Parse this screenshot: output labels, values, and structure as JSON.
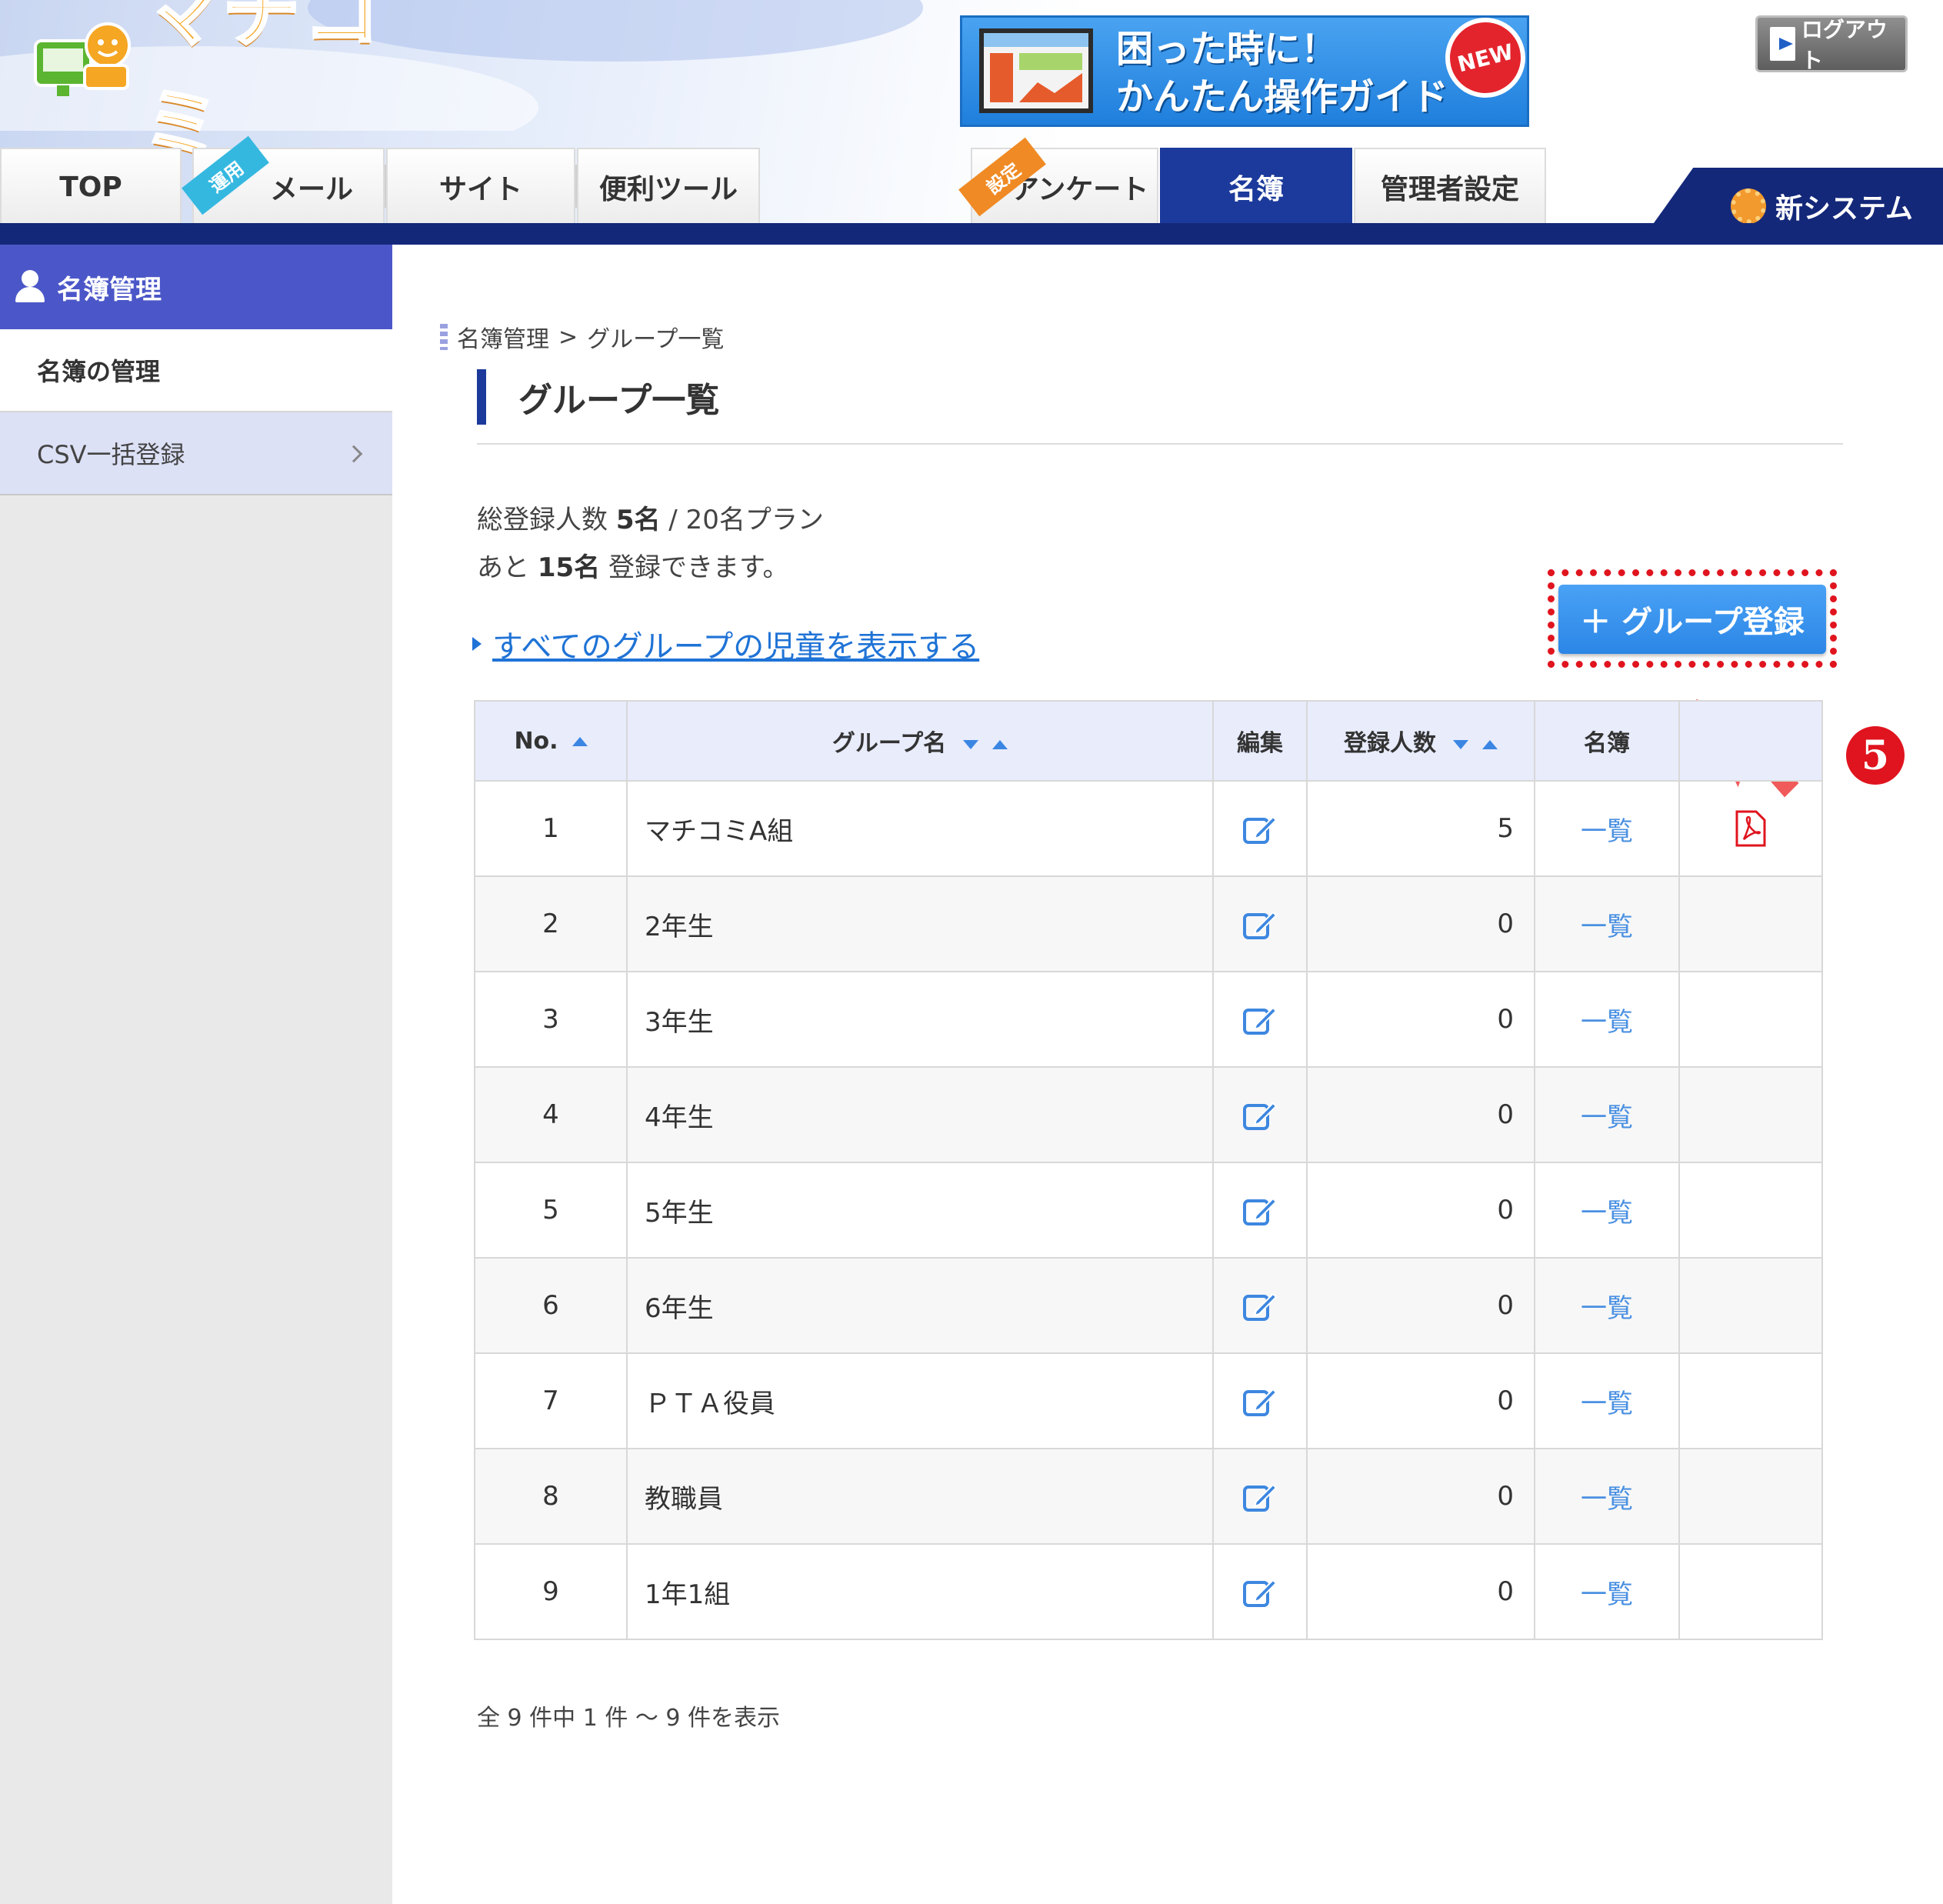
{
  "app": {
    "logo_text": "マチコミ",
    "guide_banner": {
      "line1": "困った時に！",
      "line2": "かんたん操作ガイド",
      "badge": "NEW"
    },
    "logout_label": "ログアウト",
    "new_system_label": "新システム"
  },
  "nav": {
    "tabs": [
      {
        "label": "TOP"
      },
      {
        "label": "メール",
        "ribbon": "運用"
      },
      {
        "label": "サイト"
      },
      {
        "label": "便利ツール"
      },
      {
        "label": "アンケート",
        "ribbon": "設定"
      },
      {
        "label": "名簿",
        "active": true
      },
      {
        "label": "管理者設定"
      }
    ]
  },
  "sidebar": {
    "header": "名簿管理",
    "items": [
      {
        "label": "名簿の管理"
      },
      {
        "label": "CSV一括登録"
      }
    ]
  },
  "main": {
    "breadcrumb": {
      "parent": "名簿管理",
      "separator": ">",
      "current": "グループ一覧"
    },
    "title": "グループ一覧",
    "count": {
      "prefix": "総登録人数",
      "registered": "5名",
      "plan": "/ 20名プラン",
      "remaining_prefix": "あと",
      "remaining": "15名",
      "remaining_suffix": "登録できます。"
    },
    "show_all_link": "すべてのグループの児童を表示する",
    "register_button": "＋ グループ登録",
    "step_number": "5",
    "paging_info": "全 9 件中 1 件 ～ 9 件を表示"
  },
  "table": {
    "headers": {
      "no": "No.",
      "name": "グループ名",
      "edit": "編集",
      "count": "登録人数",
      "list": "名簿",
      "file": ""
    },
    "rows": [
      {
        "no": "1",
        "name": "マチコミA組",
        "count": "5",
        "list": "一覧",
        "pdf": true
      },
      {
        "no": "2",
        "name": "2年生",
        "count": "0",
        "list": "一覧",
        "pdf": false
      },
      {
        "no": "3",
        "name": "3年生",
        "count": "0",
        "list": "一覧",
        "pdf": false
      },
      {
        "no": "4",
        "name": "4年生",
        "count": "0",
        "list": "一覧",
        "pdf": false
      },
      {
        "no": "5",
        "name": "5年生",
        "count": "0",
        "list": "一覧",
        "pdf": false
      },
      {
        "no": "6",
        "name": "6年生",
        "count": "0",
        "list": "一覧",
        "pdf": false
      },
      {
        "no": "7",
        "name": "ＰＴＡ役員",
        "count": "0",
        "list": "一覧",
        "pdf": false
      },
      {
        "no": "8",
        "name": "教職員",
        "count": "0",
        "list": "一覧",
        "pdf": false
      },
      {
        "no": "9",
        "name": "1年1組",
        "count": "0",
        "list": "一覧",
        "pdf": false
      }
    ]
  },
  "colors": {
    "nav_blue": "#14287a",
    "active_tab": "#1b3a9b",
    "sidebar_header": "#4b57c8",
    "link_blue": "#1f73d6",
    "button_blue": "#2b86e6",
    "highlight_red": "#e0141e",
    "logo_orange": "#f5a623"
  },
  "icons": [
    "logo-icon",
    "monitor-icon",
    "logout-icon",
    "gear-icon",
    "user-icon",
    "chevron-right-icon",
    "link-triangle-icon",
    "plus-icon",
    "cursor-arrow-icon",
    "sort-up-icon",
    "sort-down-icon",
    "edit-icon",
    "pdf-icon"
  ]
}
